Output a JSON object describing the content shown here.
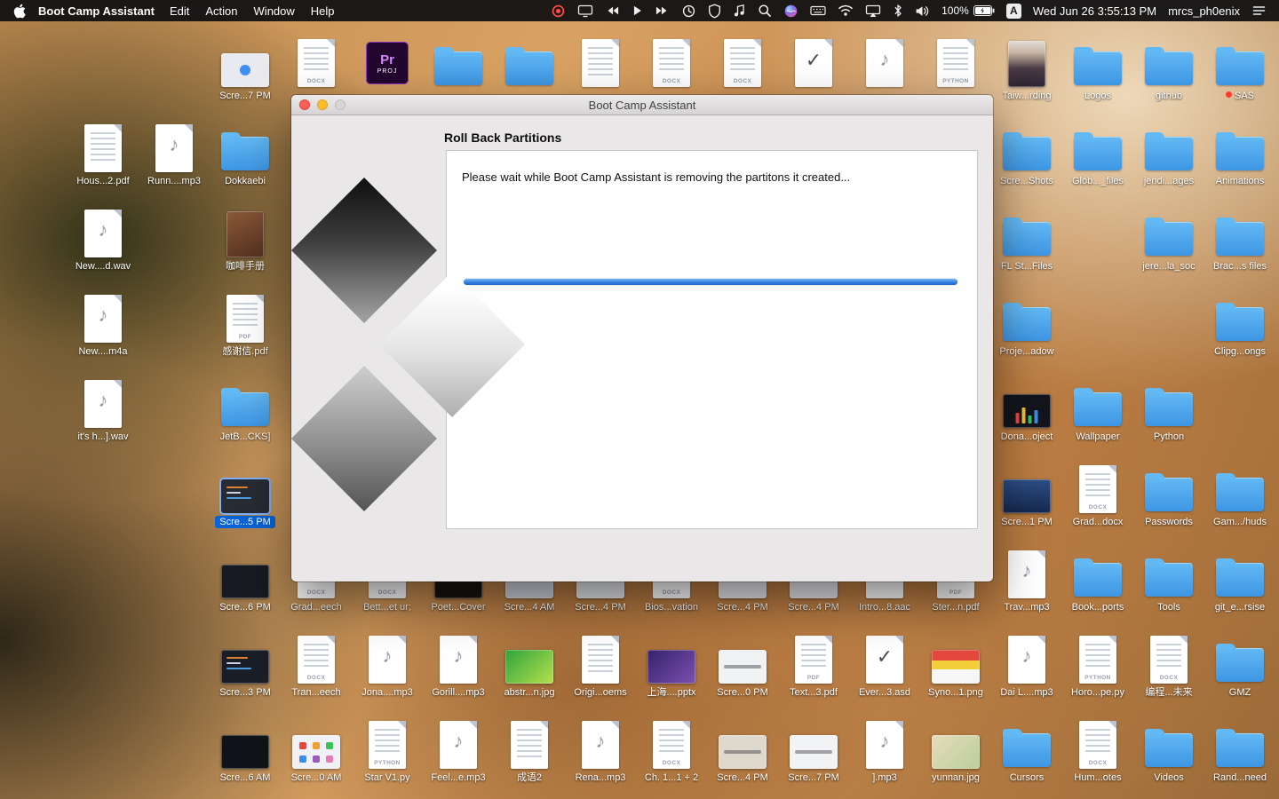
{
  "menu_bar": {
    "app_name": "Boot Camp Assistant",
    "menus": [
      "Edit",
      "Action",
      "Window",
      "Help"
    ],
    "status": {
      "icons": [
        "screen-recording-icon",
        "display-icon",
        "rewind-icon",
        "play-icon",
        "fast-forward-icon",
        "time-machine-icon",
        "security-icon",
        "music-icon",
        "spotlight-icon",
        "siri-icon",
        "keyboard-icon",
        "wifi-icon",
        "airplay-icon",
        "bluetooth-icon",
        "volume-icon"
      ],
      "battery_percent": "100%",
      "input_source": "A",
      "clock": "Wed Jun 26 3:55:13 PM",
      "username": "mrcs_ph0enix",
      "menu_list_icon": "list-icon"
    }
  },
  "window": {
    "title": "Boot Camp Assistant",
    "heading": "Roll Back Partitions",
    "message": "Please wait while Boot Camp Assistant is removing the partitons it created...",
    "progress_percent": 100,
    "accent_color": "#2f7ce0"
  },
  "desktop": {
    "icons": [
      {
        "l": "Scre...7 PM",
        "t": "shot",
        "c": 2,
        "r": 0,
        "bg": "#e8eaef",
        "v": "dot"
      },
      {
        "l": "",
        "t": "docx",
        "c": 3,
        "r": 0
      },
      {
        "l": "",
        "t": "premiere",
        "c": 4,
        "r": 0
      },
      {
        "l": "",
        "t": "folder",
        "c": 5,
        "r": 0
      },
      {
        "l": "",
        "t": "folder",
        "c": 6,
        "r": 0
      },
      {
        "l": "",
        "t": "doc",
        "c": 7,
        "r": 0
      },
      {
        "l": "",
        "t": "docx",
        "c": 8,
        "r": 0
      },
      {
        "l": "",
        "t": "docx",
        "c": 9,
        "r": 0
      },
      {
        "l": "",
        "t": "check",
        "c": 10,
        "r": 0
      },
      {
        "l": "",
        "t": "audio",
        "c": 11,
        "r": 0
      },
      {
        "l": "",
        "t": "python",
        "c": 12,
        "r": 0
      },
      {
        "l": "Taiw...rding",
        "t": "img",
        "c": 13,
        "r": 0,
        "bg": "linear-gradient(180deg,#e3dcd6 0%,#c9b6a6 25%,#4a3a44 60%,#2c2432 100%)",
        "v": "portrait"
      },
      {
        "l": "Logos",
        "t": "folder",
        "c": 14,
        "r": 0
      },
      {
        "l": "github",
        "t": "folder",
        "c": 15,
        "r": 0
      },
      {
        "l": "SAS",
        "t": "folder",
        "c": 16,
        "r": 0,
        "tag": "#ff3b30"
      },
      {
        "l": "Hous...2.pdf",
        "t": "doc",
        "c": 0,
        "r": 1
      },
      {
        "l": "Runn....mp3",
        "t": "audio",
        "c": 1,
        "r": 1
      },
      {
        "l": "Dokkaebi",
        "t": "folder",
        "c": 2,
        "r": 1
      },
      {
        "l": "Scre...Shots",
        "t": "folder",
        "c": 13,
        "r": 1
      },
      {
        "l": "Glob..._files",
        "t": "folder",
        "c": 14,
        "r": 1
      },
      {
        "l": "jendi...ages",
        "t": "folder",
        "c": 15,
        "r": 1
      },
      {
        "l": "Animations",
        "t": "folder",
        "c": 16,
        "r": 1
      },
      {
        "l": "New....d.wav",
        "t": "audio",
        "c": 0,
        "r": 2
      },
      {
        "l": "咖啡手册",
        "t": "img",
        "c": 2,
        "r": 2,
        "bg": "linear-gradient(160deg,#8a5a38,#553020)",
        "v": "portrait"
      },
      {
        "l": "FL St...Files",
        "t": "folder",
        "c": 13,
        "r": 2
      },
      {
        "l": "jere...la_soc",
        "t": "folder",
        "c": 15,
        "r": 2
      },
      {
        "l": "Brac...s files",
        "t": "folder",
        "c": 16,
        "r": 2
      },
      {
        "l": "New....m4a",
        "t": "audio",
        "c": 0,
        "r": 3
      },
      {
        "l": "感谢信.pdf",
        "t": "pdf",
        "c": 2,
        "r": 3
      },
      {
        "l": "Proje...adow",
        "t": "folder",
        "c": 13,
        "r": 3
      },
      {
        "l": "Clipg...ongs",
        "t": "folder",
        "c": 16,
        "r": 3
      },
      {
        "l": "it's h...].wav",
        "t": "audio",
        "c": 0,
        "r": 4
      },
      {
        "l": "JetB...CKS]",
        "t": "folder",
        "c": 2,
        "r": 4
      },
      {
        "l": "Dona...oject",
        "t": "img",
        "c": 13,
        "r": 4,
        "bg": "#14141c",
        "v": "eq"
      },
      {
        "l": "Wallpaper",
        "t": "folder",
        "c": 14,
        "r": 4
      },
      {
        "l": "Python",
        "t": "folder",
        "c": 15,
        "r": 4
      },
      {
        "l": "Scre...5 PM",
        "t": "shot",
        "c": 2,
        "r": 5,
        "bg": "#272b34",
        "v": "code",
        "sel": true
      },
      {
        "l": "Scre...1 PM",
        "t": "shot",
        "c": 13,
        "r": 5,
        "bg": "linear-gradient(#2c4f86,#15294d)"
      },
      {
        "l": "Grad...docx",
        "t": "docx",
        "c": 14,
        "r": 5
      },
      {
        "l": "Passwords",
        "t": "folder",
        "c": 15,
        "r": 5
      },
      {
        "l": "Gam.../huds",
        "t": "folder",
        "c": 16,
        "r": 5
      },
      {
        "l": "Scre...6 PM",
        "t": "shot",
        "c": 2,
        "r": 6,
        "bg": "#171a21"
      },
      {
        "l": "Grad...eech",
        "t": "docx",
        "c": 3,
        "r": 6
      },
      {
        "l": "Bett...et ur;",
        "t": "docx",
        "c": 4,
        "r": 6
      },
      {
        "l": "Poet...Cover",
        "t": "img",
        "c": 5,
        "r": 6,
        "bg": "#17130f"
      },
      {
        "l": "Scre...4 AM",
        "t": "img",
        "c": 6,
        "r": 6,
        "bg": "#ccd2d9"
      },
      {
        "l": "Scre...4 PM",
        "t": "shot",
        "c": 7,
        "r": 6,
        "bg": "#e3e6ea"
      },
      {
        "l": "Bios...vation",
        "t": "docx",
        "c": 8,
        "r": 6
      },
      {
        "l": "Scre...4 PM",
        "t": "shot",
        "c": 9,
        "r": 6,
        "bg": "#e8e9ee"
      },
      {
        "l": "Scre...4 PM",
        "t": "shot",
        "c": 10,
        "r": 6,
        "bg": "#e8e9ee"
      },
      {
        "l": "Intro...8.aac",
        "t": "audio",
        "c": 11,
        "r": 6
      },
      {
        "l": "Ster...n.pdf",
        "t": "pdf",
        "c": 12,
        "r": 6
      },
      {
        "l": "Trav...mp3",
        "t": "audio",
        "c": 13,
        "r": 6
      },
      {
        "l": "Book...ports",
        "t": "folder",
        "c": 14,
        "r": 6
      },
      {
        "l": "Tools",
        "t": "folder",
        "c": 15,
        "r": 6
      },
      {
        "l": "git_e...rsise",
        "t": "folder",
        "c": 16,
        "r": 6
      },
      {
        "l": "Scre...3 PM",
        "t": "shot",
        "c": 2,
        "r": 7,
        "bg": "#191d26",
        "v": "code"
      },
      {
        "l": "Tran...eech",
        "t": "docx",
        "c": 3,
        "r": 7
      },
      {
        "l": "Jona....mp3",
        "t": "audio",
        "c": 4,
        "r": 7
      },
      {
        "l": "Gorill....mp3",
        "t": "audio",
        "c": 5,
        "r": 7
      },
      {
        "l": "abstr...n.jpg",
        "t": "img",
        "c": 6,
        "r": 7,
        "bg": "linear-gradient(135deg,#2fa43e,#b5e04c)"
      },
      {
        "l": "Origi...oems",
        "t": "doc",
        "c": 7,
        "r": 7
      },
      {
        "l": "上海....pptx",
        "t": "img",
        "c": 8,
        "r": 7,
        "bg": "linear-gradient(135deg,#35246b,#7c4fb0)"
      },
      {
        "l": "Scre...0 PM",
        "t": "shot",
        "c": 9,
        "r": 7,
        "bg": "#f1f2f4",
        "v": "bar"
      },
      {
        "l": "Text...3.pdf",
        "t": "pdf",
        "c": 10,
        "r": 7
      },
      {
        "l": "Ever...3.asd",
        "t": "check",
        "c": 11,
        "r": 7
      },
      {
        "l": "Syno...1.png",
        "t": "img",
        "c": 12,
        "r": 7,
        "bg": "linear-gradient(180deg,#e4483c 0%,#e4483c 32%,#f2cf3a 32%,#f2cf3a 58%,#f6f6f6 58%)"
      },
      {
        "l": "Dai L....mp3",
        "t": "audio",
        "c": 13,
        "r": 7
      },
      {
        "l": "Horo...pe.py",
        "t": "python",
        "c": 14,
        "r": 7
      },
      {
        "l": "编程...未来",
        "t": "docx",
        "c": 15,
        "r": 7
      },
      {
        "l": "GMZ",
        "t": "folder",
        "c": 16,
        "r": 7
      },
      {
        "l": "Scre...6 AM",
        "t": "shot",
        "c": 2,
        "r": 8,
        "bg": "#0f1217"
      },
      {
        "l": "Scre...0 AM",
        "t": "img",
        "c": 3,
        "r": 8,
        "bg": "#f0f1f4",
        "v": "grid"
      },
      {
        "l": "Star V1.py",
        "t": "python",
        "c": 4,
        "r": 8
      },
      {
        "l": "Feel...e.mp3",
        "t": "audio",
        "c": 5,
        "r": 8
      },
      {
        "l": "成语2",
        "t": "doc",
        "c": 6,
        "r": 8
      },
      {
        "l": "Rena...mp3",
        "t": "audio",
        "c": 7,
        "r": 8
      },
      {
        "l": "Ch. 1...1 + 2",
        "t": "docx",
        "c": 8,
        "r": 8
      },
      {
        "l": "Scre...4 PM",
        "t": "img",
        "c": 9,
        "r": 8,
        "bg": "#ded8cd",
        "v": "bar"
      },
      {
        "l": "Scre...7 PM",
        "t": "shot",
        "c": 10,
        "r": 8,
        "bg": "#f2f3f5",
        "v": "bar"
      },
      {
        "l": "].mp3",
        "t": "audio",
        "c": 11,
        "r": 8
      },
      {
        "l": "yunnan.jpg",
        "t": "img",
        "c": 12,
        "r": 8,
        "bg": "linear-gradient(135deg,#e6dcbb,#b9cf9a)"
      },
      {
        "l": "Cursors",
        "t": "folder",
        "c": 13,
        "r": 8
      },
      {
        "l": "Hum...otes",
        "t": "docx",
        "c": 14,
        "r": 8
      },
      {
        "l": "Videos",
        "t": "folder",
        "c": 15,
        "r": 8
      },
      {
        "l": "Rand...need",
        "t": "folder",
        "c": 16,
        "r": 8
      }
    ]
  }
}
